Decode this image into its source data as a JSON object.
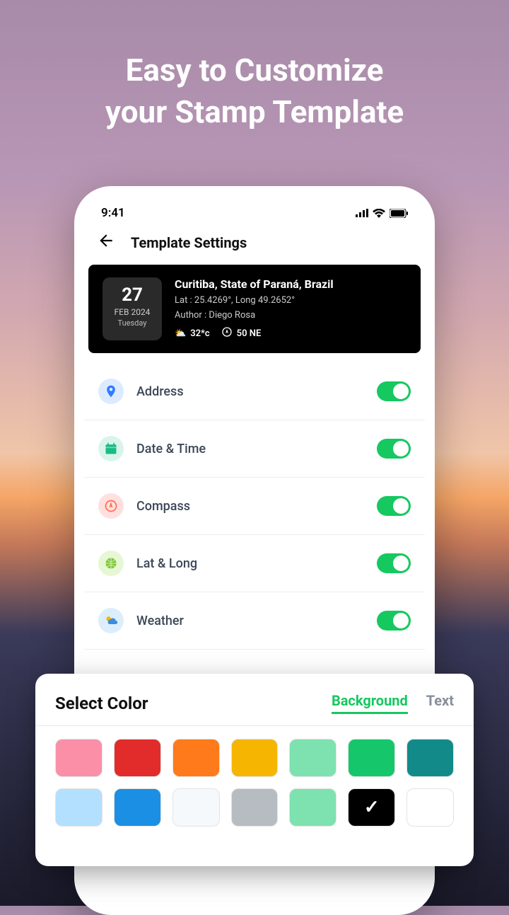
{
  "headline_l1": "Easy to Customize",
  "headline_l2": "your Stamp Template",
  "status": {
    "time": "9:41"
  },
  "navbar": {
    "title": "Template Settings"
  },
  "preview": {
    "day": "27",
    "month": "FEB 2024",
    "weekday": "Tuesday",
    "location": "Curitiba, State of Paraná, Brazil",
    "latlong": "Lat : 25.4269°, Long 49.2652°",
    "author": "Author : Diego Rosa",
    "temp": "32*c",
    "compass": "50 NE"
  },
  "settings": [
    {
      "key": "address",
      "label": "Address",
      "iconbg": "bg-blue",
      "iconColor": "#2f7cff",
      "on": true
    },
    {
      "key": "datetime",
      "label": "Date & Time",
      "iconbg": "bg-teal",
      "iconColor": "#18bb86",
      "on": true
    },
    {
      "key": "compass",
      "label": "Compass",
      "iconbg": "bg-red",
      "iconColor": "#ff6a4d",
      "on": true
    },
    {
      "key": "latlong",
      "label": "Lat & Long",
      "iconbg": "bg-lime",
      "iconColor": "#7cc838",
      "on": true
    },
    {
      "key": "weather",
      "label": "Weather",
      "iconbg": "bg-sky",
      "iconColor": "#3a8dde",
      "on": true
    }
  ],
  "colorpanel": {
    "title": "Select Color",
    "tabs": {
      "background": "Background",
      "text": "Text",
      "active": "background"
    },
    "colors": [
      "#fb8fa8",
      "#e22b2b",
      "#ff7a1a",
      "#f6b500",
      "#7de2af",
      "#15c76a",
      "#138a8a",
      "#b3e0ff",
      "#1b8fe3",
      "#f6f9fb",
      "#b6bcc1",
      "#7de2af",
      "#000000",
      "#ffffff"
    ],
    "selectedIndex": 12
  }
}
